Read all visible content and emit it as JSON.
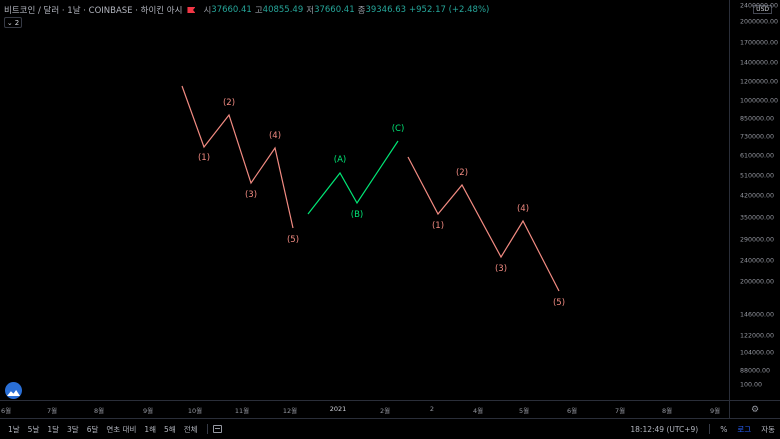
{
  "header": {
    "title": "비트코인 / 달러 · 1날 · COINBASE · 하이킨 아시",
    "open_label": "시",
    "open": "37660.41",
    "high_label": "고",
    "high": "40855.49",
    "low_label": "저",
    "low": "37660.41",
    "close_label": "종",
    "close": "39346.63",
    "change": "+952.17 (+2.48%)"
  },
  "indicators_badge": "2",
  "currency": "USD",
  "price_ticks": [
    {
      "label": "2400000.00",
      "value": 2400000
    },
    {
      "label": "2000000.00",
      "value": 2000000
    },
    {
      "label": "1700000.00",
      "value": 1700000
    },
    {
      "label": "1400000.00",
      "value": 1400000
    },
    {
      "label": "1200000.00",
      "value": 1200000
    },
    {
      "label": "1000000.00",
      "value": 1000000
    },
    {
      "label": "850000.00",
      "value": 850000
    },
    {
      "label": "730000.00",
      "value": 730000
    },
    {
      "label": "610000.00",
      "value": 610000
    },
    {
      "label": "510000.00",
      "value": 510000
    },
    {
      "label": "420000.00",
      "value": 420000
    },
    {
      "label": "350000.00",
      "value": 350000
    },
    {
      "label": "290000.00",
      "value": 290000
    },
    {
      "label": "240000.00",
      "value": 240000
    },
    {
      "label": "200000.00",
      "value": 200000
    },
    {
      "label": "146000.00",
      "value": 146000
    },
    {
      "label": "122000.00",
      "value": 122000
    },
    {
      "label": "104000.00",
      "value": 104000
    },
    {
      "label": "88000.00",
      "value": 88000
    },
    {
      "label": "100.00",
      "value": 100
    }
  ],
  "time_ticks": [
    {
      "label": "6월",
      "bold": false
    },
    {
      "label": "7월",
      "bold": false
    },
    {
      "label": "8월",
      "bold": false
    },
    {
      "label": "9월",
      "bold": false
    },
    {
      "label": "10월",
      "bold": false
    },
    {
      "label": "11월",
      "bold": false
    },
    {
      "label": "12월",
      "bold": false
    },
    {
      "label": "2021",
      "bold": true
    },
    {
      "label": "2월",
      "bold": false
    },
    {
      "label": "2",
      "bold": false
    },
    {
      "label": "4월",
      "bold": false
    },
    {
      "label": "5월",
      "bold": false
    },
    {
      "label": "6월",
      "bold": false
    },
    {
      "label": "7월",
      "bold": false
    },
    {
      "label": "8월",
      "bold": false
    },
    {
      "label": "9월",
      "bold": false
    }
  ],
  "timeframes": [
    "1날",
    "5날",
    "1달",
    "3달",
    "6달",
    "연초 대비",
    "1해",
    "5해",
    "전체"
  ],
  "clock": "18:12:49 (UTC+9)",
  "options": {
    "percent": "%",
    "log": "로그",
    "auto": "자동"
  },
  "colors": {
    "impulse": "#f28b82",
    "corrective": "#00e676"
  },
  "waves": [
    {
      "name": "impulse-wave-1",
      "color": "impulse",
      "points": [
        [
          182,
          86
        ],
        [
          204,
          147
        ],
        [
          229,
          115
        ],
        [
          251,
          183
        ],
        [
          275,
          148
        ],
        [
          293,
          228
        ]
      ],
      "labels": [
        {
          "text": "(1)"
        },
        {
          "text": "(2)"
        },
        {
          "text": "(3)"
        },
        {
          "text": "(4)"
        },
        {
          "text": "(5)"
        }
      ]
    },
    {
      "name": "corrective-wave",
      "color": "corrective",
      "points": [
        [
          308,
          214
        ],
        [
          340,
          173
        ],
        [
          357,
          203
        ],
        [
          398,
          141
        ]
      ],
      "labels": [
        {
          "text": "(A)"
        },
        {
          "text": "(B)"
        },
        {
          "text": "(C)"
        }
      ]
    },
    {
      "name": "impulse-wave-2",
      "color": "impulse",
      "points": [
        [
          408,
          157
        ],
        [
          438,
          214
        ],
        [
          462,
          185
        ],
        [
          501,
          257
        ],
        [
          523,
          221
        ],
        [
          559,
          291
        ]
      ],
      "labels": [
        {
          "text": "(1)"
        },
        {
          "text": "(2)"
        },
        {
          "text": "(3)"
        },
        {
          "text": "(4)"
        },
        {
          "text": "(5)"
        }
      ]
    }
  ]
}
